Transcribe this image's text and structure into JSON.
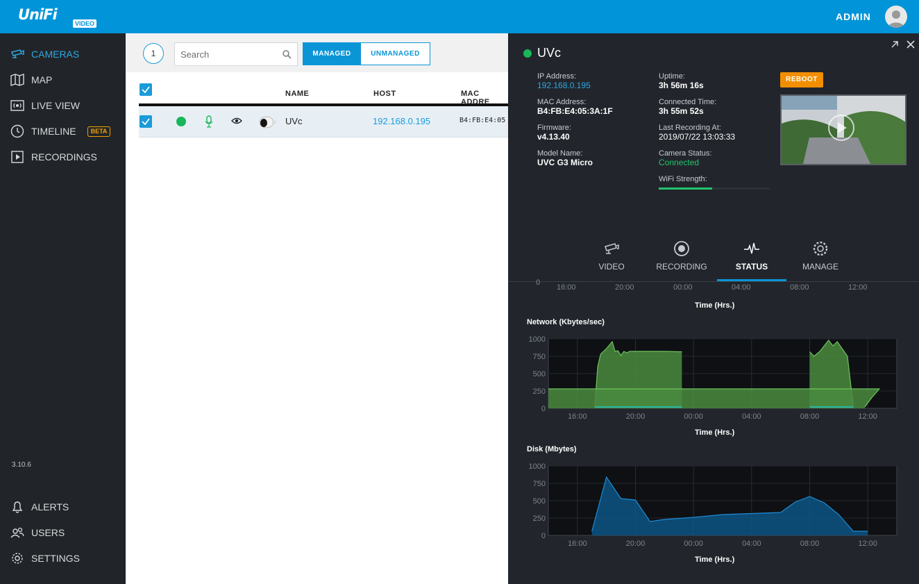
{
  "app": {
    "logo": "UniFi",
    "logo_badge": "VIDEO",
    "user": "ADMIN",
    "version": "3.10.6"
  },
  "sidebar": {
    "items": [
      {
        "label": "CAMERAS",
        "icon": "camera-icon",
        "active": true
      },
      {
        "label": "MAP",
        "icon": "map-icon"
      },
      {
        "label": "LIVE VIEW",
        "icon": "live-view-icon"
      },
      {
        "label": "TIMELINE",
        "icon": "clock-icon",
        "badge": "BETA"
      },
      {
        "label": "RECORDINGS",
        "icon": "play-square-icon"
      }
    ],
    "bottom": [
      {
        "label": "ALERTS",
        "icon": "bell-icon"
      },
      {
        "label": "USERS",
        "icon": "users-icon"
      },
      {
        "label": "SETTINGS",
        "icon": "gear-icon"
      }
    ]
  },
  "list": {
    "count": "1",
    "search_placeholder": "Search",
    "segments": {
      "managed": "MANAGED",
      "unmanaged": "UNMANAGED"
    },
    "columns": {
      "name": "NAME",
      "host": "HOST",
      "mac": "MAC ADDRE"
    },
    "rows": [
      {
        "name": "UVc",
        "host": "192.168.0.195",
        "mac": "B4:FB:E4:05"
      }
    ]
  },
  "panel": {
    "title": "UVc",
    "reboot": "REBOOT",
    "info": {
      "ip_label": "IP Address:",
      "ip": "192.168.0.195",
      "mac_label": "MAC Address:",
      "mac": "B4:FB:E4:05:3A:1F",
      "fw_label": "Firmware:",
      "fw": "v4.13.40",
      "model_label": "Model Name:",
      "model": "UVC G3 Micro",
      "uptime_label": "Uptime:",
      "uptime": "3h 56m 16s",
      "conn_label": "Connected Time:",
      "conn": "3h 55m 52s",
      "lastrec_label": "Last Recording At:",
      "lastrec": "2019/07/22 13:03:33",
      "status_label": "Camera Status:",
      "status": "Connected",
      "wifi_label": "WiFi Strength:",
      "wifi_fraction": 0.48
    },
    "tabs": [
      {
        "label": "VIDEO",
        "icon": "camera-icon"
      },
      {
        "label": "RECORDING",
        "icon": "record-icon"
      },
      {
        "label": "STATUS",
        "icon": "pulse-icon",
        "active": true
      },
      {
        "label": "MANAGE",
        "icon": "gear-icon"
      }
    ],
    "time_axis_title": "Time (Hrs.)",
    "top_partial_axis": {
      "ticks": [
        "16:00",
        "20:00",
        "00:00",
        "04:00",
        "08:00",
        "12:00"
      ],
      "zero": "0"
    }
  },
  "chart_data": [
    {
      "type": "area",
      "title": "Network (Kbytes/sec)",
      "xlabel": "Time (Hrs.)",
      "x_ticks": [
        "16:00",
        "20:00",
        "00:00",
        "04:00",
        "08:00",
        "12:00"
      ],
      "y_ticks": [
        0,
        250,
        500,
        750,
        1000
      ],
      "ylim": [
        0,
        1000
      ],
      "color_fill": "#4a8b3f",
      "color_line": "#6fc25f",
      "series": [
        {
          "values": [
            [
              17.2,
              30
            ],
            [
              17.4,
              600
            ],
            [
              17.6,
              780
            ],
            [
              18.0,
              860
            ],
            [
              18.4,
              960
            ],
            [
              18.6,
              820
            ],
            [
              18.8,
              830
            ],
            [
              19.0,
              760
            ],
            [
              19.2,
              820
            ],
            [
              19.4,
              800
            ],
            [
              19.6,
              820
            ],
            [
              20.0,
              820
            ],
            [
              21.0,
              820
            ],
            [
              22.0,
              820
            ],
            [
              23.0,
              815
            ],
            [
              23.2,
              815
            ]
          ]
        },
        {
          "values": [
            [
              8.0,
              815
            ],
            [
              8.3,
              750
            ],
            [
              8.7,
              820
            ],
            [
              9.0,
              900
            ],
            [
              9.3,
              980
            ],
            [
              9.6,
              900
            ],
            [
              9.9,
              960
            ],
            [
              10.3,
              840
            ],
            [
              10.6,
              750
            ],
            [
              11.0,
              30
            ]
          ]
        },
        {
          "values": [
            [
              11.8,
              20
            ],
            [
              12.3,
              160
            ],
            [
              12.8,
              280
            ],
            [
              14.0,
              280
            ]
          ]
        }
      ],
      "baseline_series": {
        "values": [
          [
            17.2,
            20
          ],
          [
            23.2,
            20
          ],
          [
            8.0,
            20
          ],
          [
            11.0,
            20
          ]
        ],
        "color": "#2ab4a6"
      }
    },
    {
      "type": "area",
      "title": "Disk (Mbytes)",
      "xlabel": "Time (Hrs.)",
      "x_ticks": [
        "16:00",
        "20:00",
        "00:00",
        "04:00",
        "08:00",
        "12:00"
      ],
      "y_ticks": [
        0,
        250,
        500,
        750,
        1000
      ],
      "ylim": [
        0,
        1000
      ],
      "color_fill": "#0c5586",
      "color_line": "#1f8bd4",
      "series": [
        {
          "values": [
            [
              17.0,
              60
            ],
            [
              18.0,
              840
            ],
            [
              19.0,
              530
            ],
            [
              20.0,
              510
            ],
            [
              21.0,
              200
            ],
            [
              22.0,
              230
            ],
            [
              24.0,
              260
            ],
            [
              26.0,
              300
            ],
            [
              30.0,
              330
            ],
            [
              31.0,
              480
            ],
            [
              32.0,
              560
            ],
            [
              33.0,
              470
            ],
            [
              34.0,
              300
            ],
            [
              35.0,
              60
            ],
            [
              36.0,
              60
            ]
          ]
        }
      ]
    }
  ]
}
